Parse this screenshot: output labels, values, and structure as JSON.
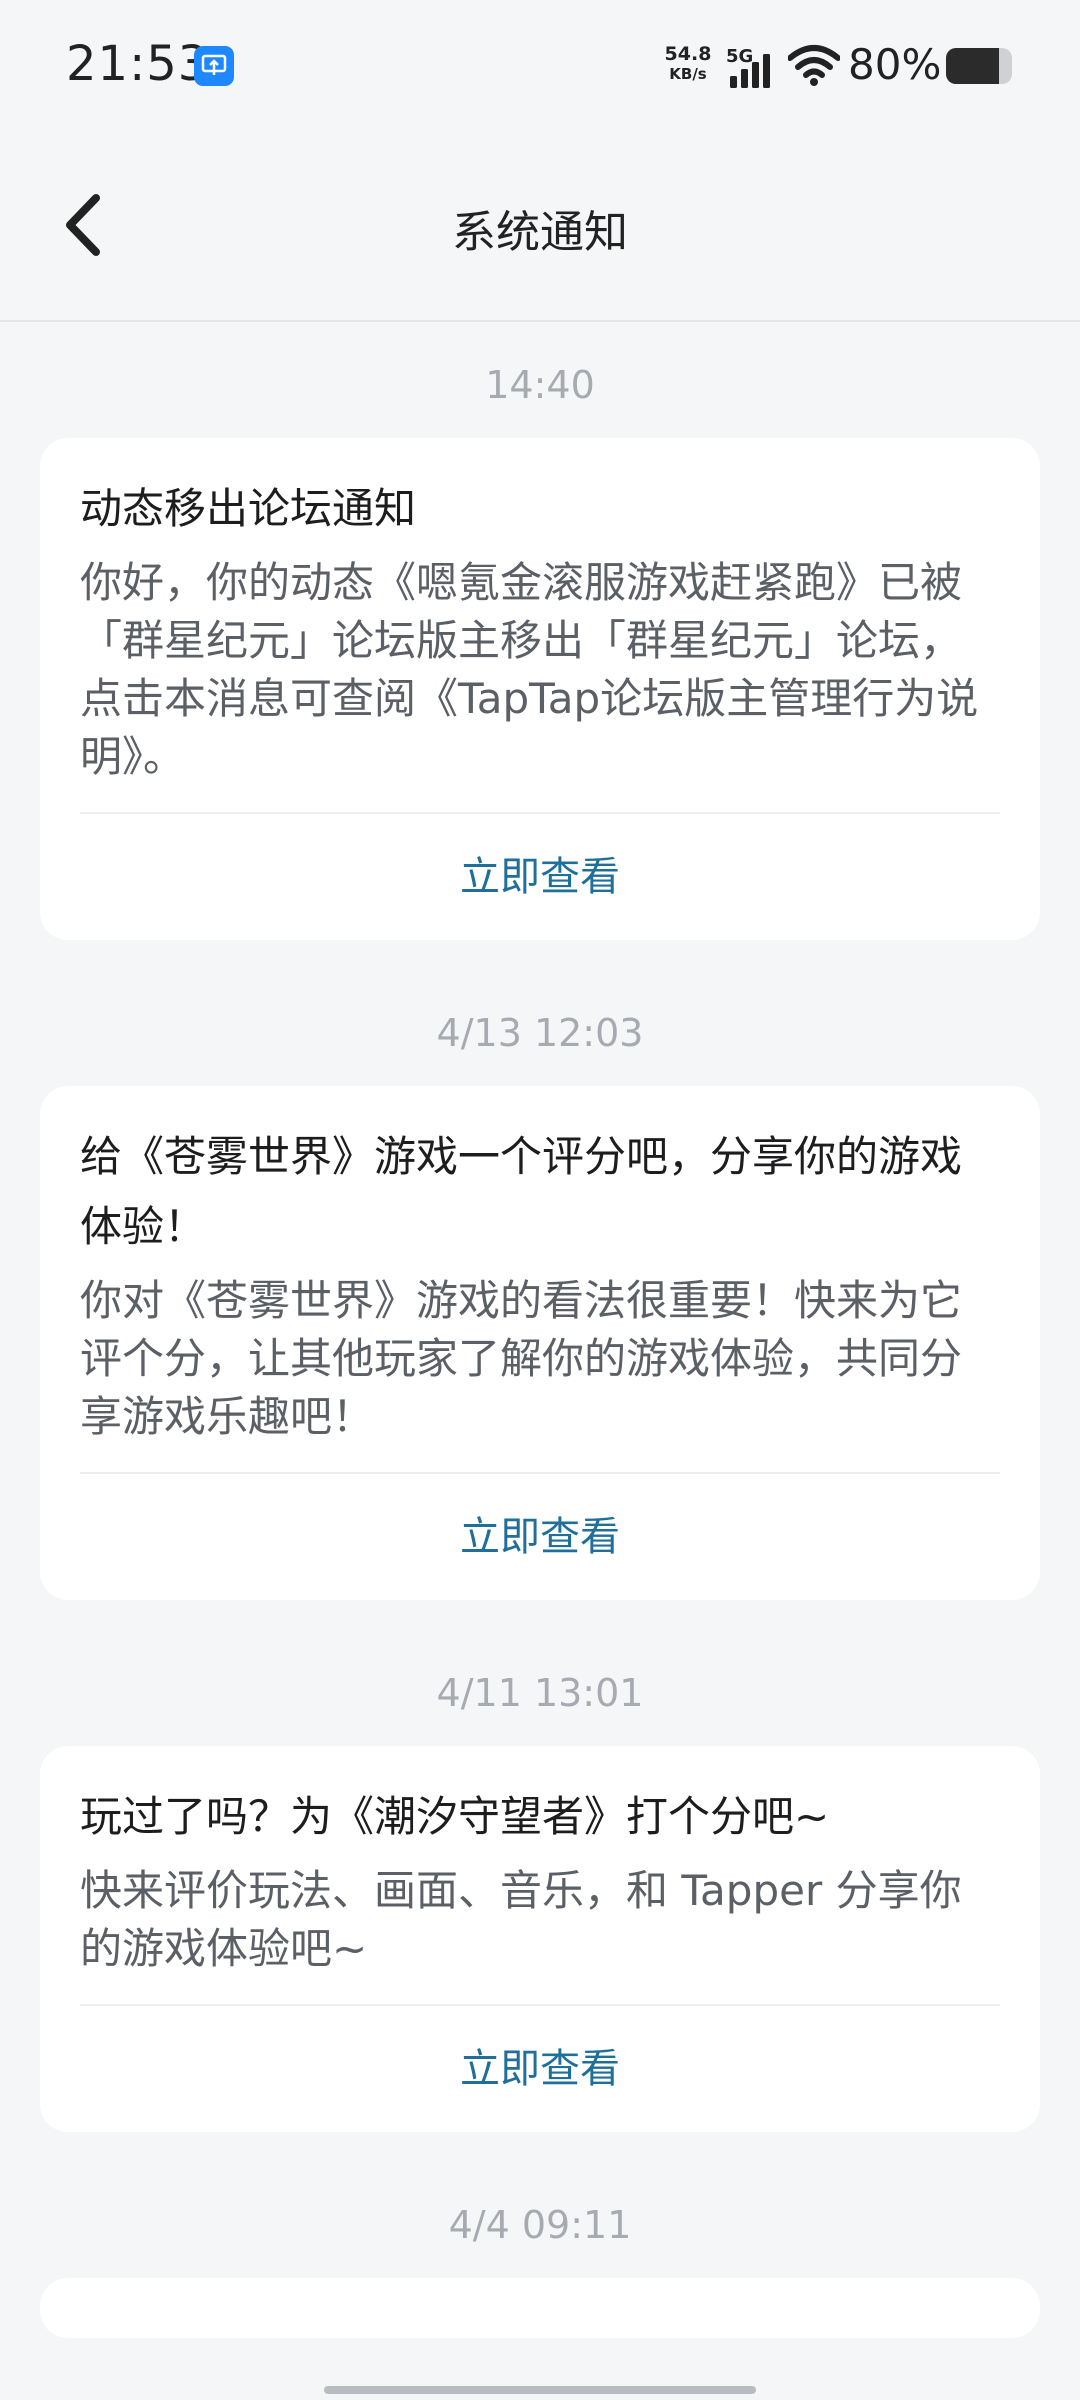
{
  "status_bar": {
    "time": "21:53",
    "net_speed_value": "54.8",
    "net_speed_unit": "KB/s",
    "network_type": "5G",
    "battery_percent": "80%",
    "battery_level": 0.8,
    "app_icon": "screen-cast-icon"
  },
  "header": {
    "title": "系统通知",
    "back_icon": "chevron-left-icon"
  },
  "notifications": [
    {
      "time": "14:40",
      "title": "动态移出论坛通知",
      "body": "你好，你的动态《嗯氪金滚服游戏赶紧跑》已被「群星纪元」论坛版主移出「群星纪元」论坛，点击本消息可查阅《TapTap论坛版主管理行为说明》。",
      "action": "立即查看"
    },
    {
      "time": "4/13  12:03",
      "title": "给《苍雾世界》游戏一个评分吧，分享你的游戏体验！",
      "body": "你对《苍雾世界》游戏的看法很重要！快来为它评个分，让其他玩家了解你的游戏体验，共同分享游戏乐趣吧！",
      "action": "立即查看"
    },
    {
      "time": "4/11  13:01",
      "title": "玩过了吗？为《潮汐守望者》打个分吧~",
      "body": "快来评价玩法、画面、音乐，和 Tapper 分享你的游戏体验吧~",
      "action": "立即查看"
    },
    {
      "time": "4/4  09:11"
    }
  ],
  "colors": {
    "background": "#f5f6f8",
    "card": "#ffffff",
    "action_text": "#1f6f9a",
    "time_label": "#a7abb1"
  }
}
